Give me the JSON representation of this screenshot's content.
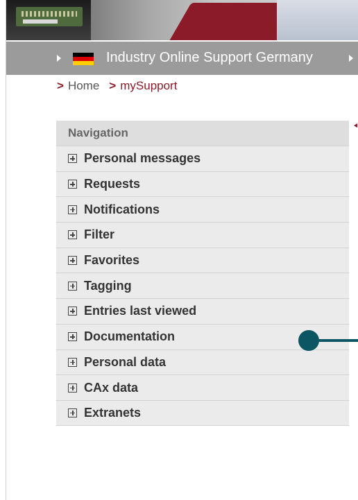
{
  "header": {
    "country_label": "Industry Online Support Germany",
    "flag_colors": [
      "#000000",
      "#dd0000",
      "#ffce00"
    ]
  },
  "breadcrumb": {
    "chevron": ">",
    "items": [
      "Home",
      "mySupport"
    ]
  },
  "navigation": {
    "title": "Navigation",
    "items": [
      "Personal messages",
      "Requests",
      "Notifications",
      "Filter",
      "Favorites",
      "Tagging",
      "Entries last viewed",
      "Documentation",
      "Personal data",
      "CAx data",
      "Extranets"
    ]
  },
  "colors": {
    "accent": "#8b1b28",
    "callout": "#0c5664",
    "bar": "#9b9b9b"
  }
}
